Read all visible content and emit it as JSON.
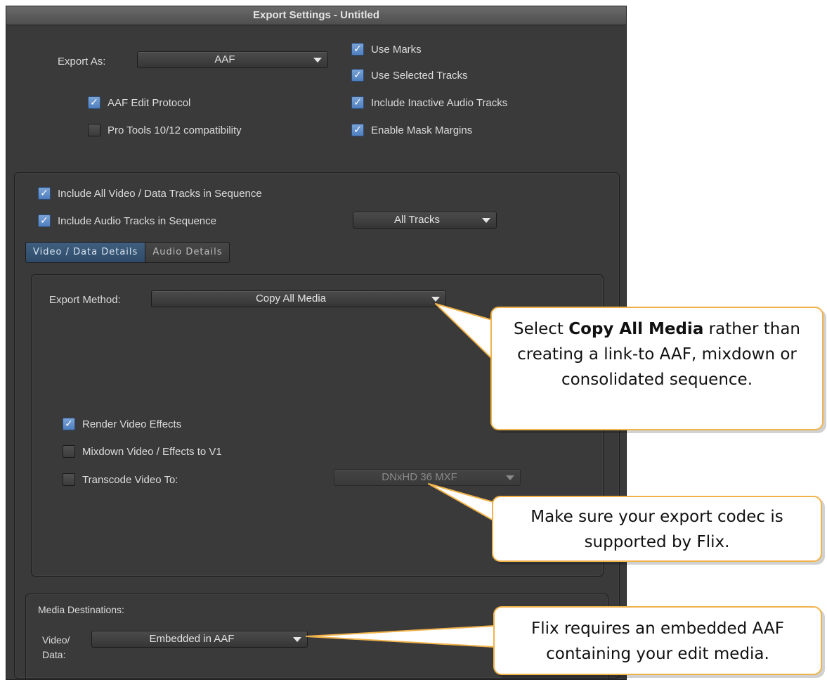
{
  "window": {
    "title": "Export Settings - Untitled"
  },
  "export_as": {
    "label": "Export As:",
    "value": "AAF"
  },
  "top_checks": [
    {
      "label": "AAF Edit Protocol",
      "checked": true
    },
    {
      "label": "Pro Tools 10/12 compatibility",
      "checked": false
    },
    {
      "label": "Use Marks",
      "checked": true
    },
    {
      "label": "Use Selected Tracks",
      "checked": true
    },
    {
      "label": "Include Inactive Audio Tracks",
      "checked": true
    },
    {
      "label": "Enable Mask Margins",
      "checked": true
    }
  ],
  "tracks": {
    "include_video": {
      "label": "Include All Video / Data Tracks in Sequence",
      "checked": true
    },
    "include_audio": {
      "label": "Include Audio Tracks in Sequence",
      "checked": true
    },
    "audio_tracks_select": "All Tracks"
  },
  "tabs": [
    {
      "label": "Video / Data Details",
      "active": true
    },
    {
      "label": "Audio Details",
      "active": false
    }
  ],
  "video_details": {
    "export_method_label": "Export Method:",
    "export_method_value": "Copy All Media",
    "render_effects": {
      "label": "Render Video Effects",
      "checked": true
    },
    "mixdown": {
      "label": "Mixdown Video / Effects to V1",
      "checked": false
    },
    "transcode": {
      "label": "Transcode Video To:",
      "checked": false
    },
    "transcode_value": "DNxHD 36  MXF"
  },
  "media_destinations": {
    "title": "Media Destinations:",
    "video_label_1": "Video/",
    "video_label_2": "Data:",
    "video_value": "Embedded in AAF"
  },
  "callouts": {
    "one": {
      "pre": "Select ",
      "bold": "Copy All Media",
      "post": " rather than creating a link-to AAF, mixdown or consolidated sequence."
    },
    "two": "Make sure your export codec is supported by Flix.",
    "three": "Flix requires an embedded AAF containing your edit media."
  },
  "colors": {
    "callout_border": "#f0b24a",
    "panel_bg": "#3a3a3a",
    "checkbox_checked": "#5f8ccb"
  }
}
